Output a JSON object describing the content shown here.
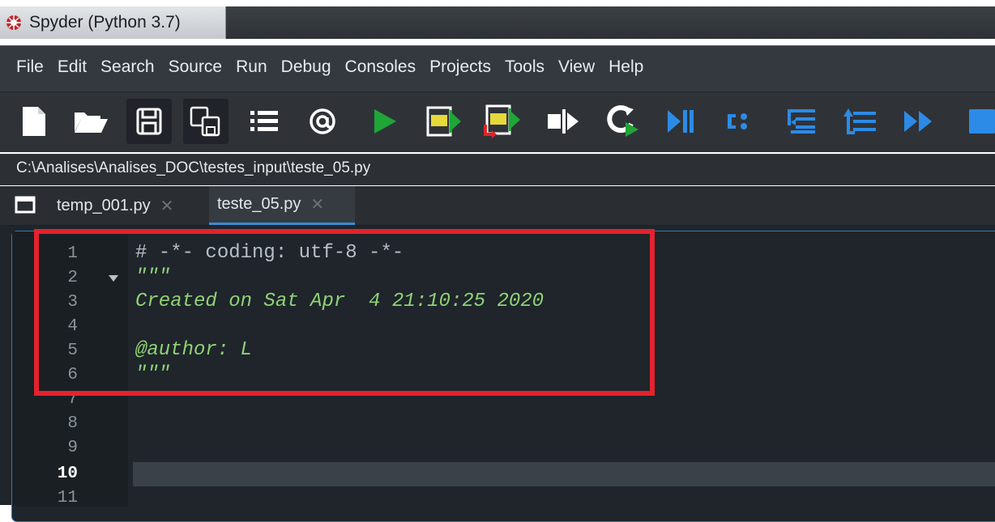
{
  "window": {
    "title": "Spyder (Python 3.7)"
  },
  "menu": [
    "File",
    "Edit",
    "Search",
    "Source",
    "Run",
    "Debug",
    "Consoles",
    "Projects",
    "Tools",
    "View",
    "Help"
  ],
  "toolbar": {
    "icons": [
      "new-file-icon",
      "open-folder-icon",
      "save-icon",
      "save-all-icon",
      "outline-list-icon",
      "at-sign-icon",
      "run-icon",
      "run-cell-icon",
      "run-cell-advance-icon",
      "run-selection-icon",
      "rerun-icon",
      "debug-icon",
      "step-icon",
      "step-into-icon",
      "step-return-icon",
      "continue-icon",
      "stop-debug-icon"
    ]
  },
  "path": "C:\\Analises\\Analises_DOC\\testes_input\\teste_05.py",
  "tabs": [
    {
      "label": "temp_001.py",
      "active": false
    },
    {
      "label": "teste_05.py",
      "active": true
    }
  ],
  "editor": {
    "line_numbers": [
      "1",
      "2",
      "3",
      "4",
      "5",
      "6",
      "7",
      "8",
      "9",
      "10",
      "11"
    ],
    "current_line": "10",
    "lines": [
      "# -*- coding: utf-8 -*-",
      "\"\"\"",
      "Created on Sat Apr  4 21:10:25 2020",
      "",
      "@author: L",
      "\"\"\""
    ]
  },
  "colors": {
    "highlight_box": "#e3232d",
    "docstring": "#8fd276",
    "comment": "#b6bec6",
    "editor_bg": "#1f252b",
    "active_tab_underline": "#3b8bd8"
  }
}
